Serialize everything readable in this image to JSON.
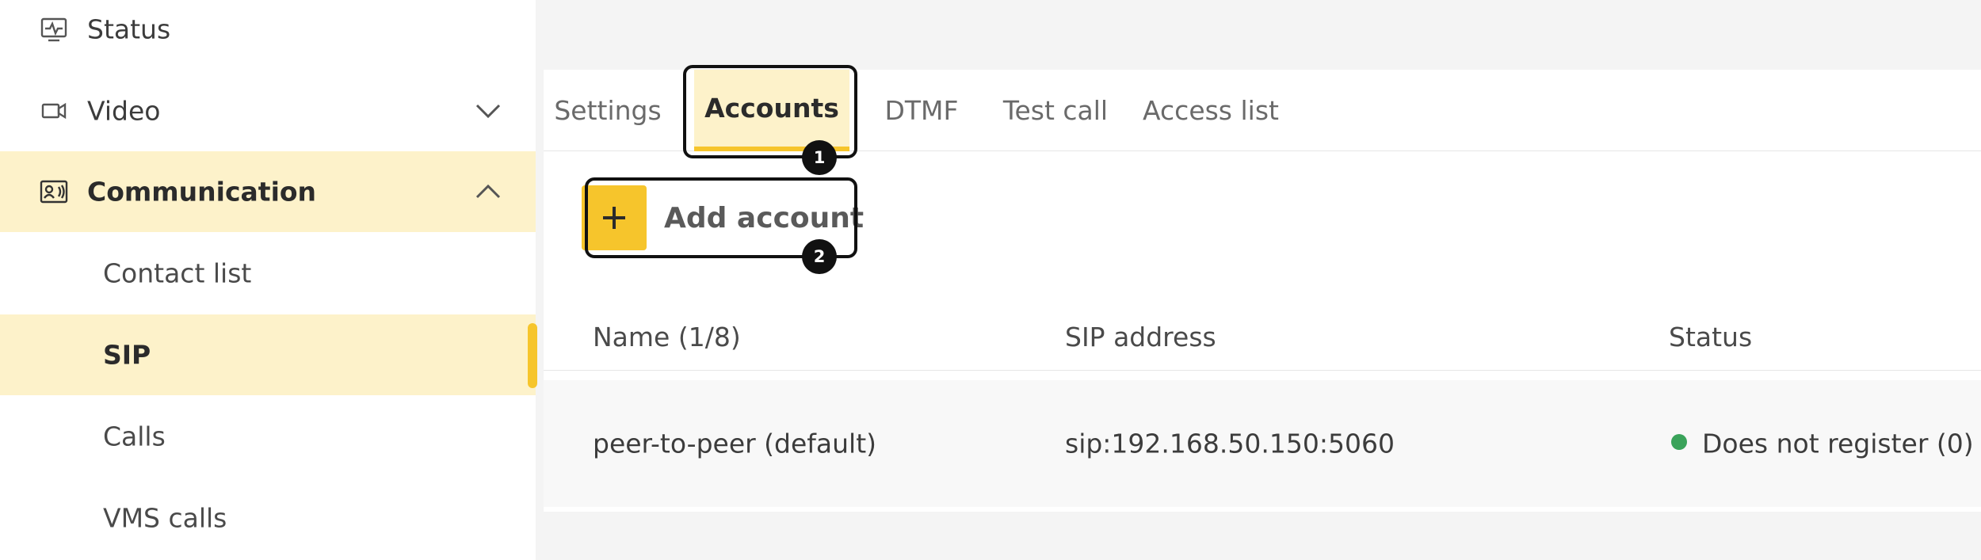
{
  "sidebar": {
    "items": [
      {
        "label": "Status",
        "icon": "status-monitor-icon"
      },
      {
        "label": "Video",
        "icon": "video-camera-icon"
      },
      {
        "label": "Communication",
        "icon": "contact-card-icon"
      }
    ],
    "sub_items": [
      {
        "label": "Contact list"
      },
      {
        "label": "SIP"
      },
      {
        "label": "Calls"
      },
      {
        "label": "VMS calls"
      }
    ]
  },
  "tabs": [
    {
      "label": "Settings"
    },
    {
      "label": "Accounts"
    },
    {
      "label": "DTMF"
    },
    {
      "label": "Test call"
    },
    {
      "label": "Access list"
    }
  ],
  "callouts": [
    "1",
    "2"
  ],
  "add_button": {
    "label": "Add account"
  },
  "table": {
    "headers": [
      "Name (1/8)",
      "SIP address",
      "Status"
    ],
    "rows": [
      {
        "name": "peer-to-peer (default)",
        "sip_address": "sip:192.168.50.150:5060",
        "status": "Does not register (0)"
      }
    ]
  },
  "colors": {
    "accent": "#f6c52c",
    "active_bg": "#fdf2ca",
    "status_ok": "#3aa35a",
    "callout": "#111111"
  }
}
